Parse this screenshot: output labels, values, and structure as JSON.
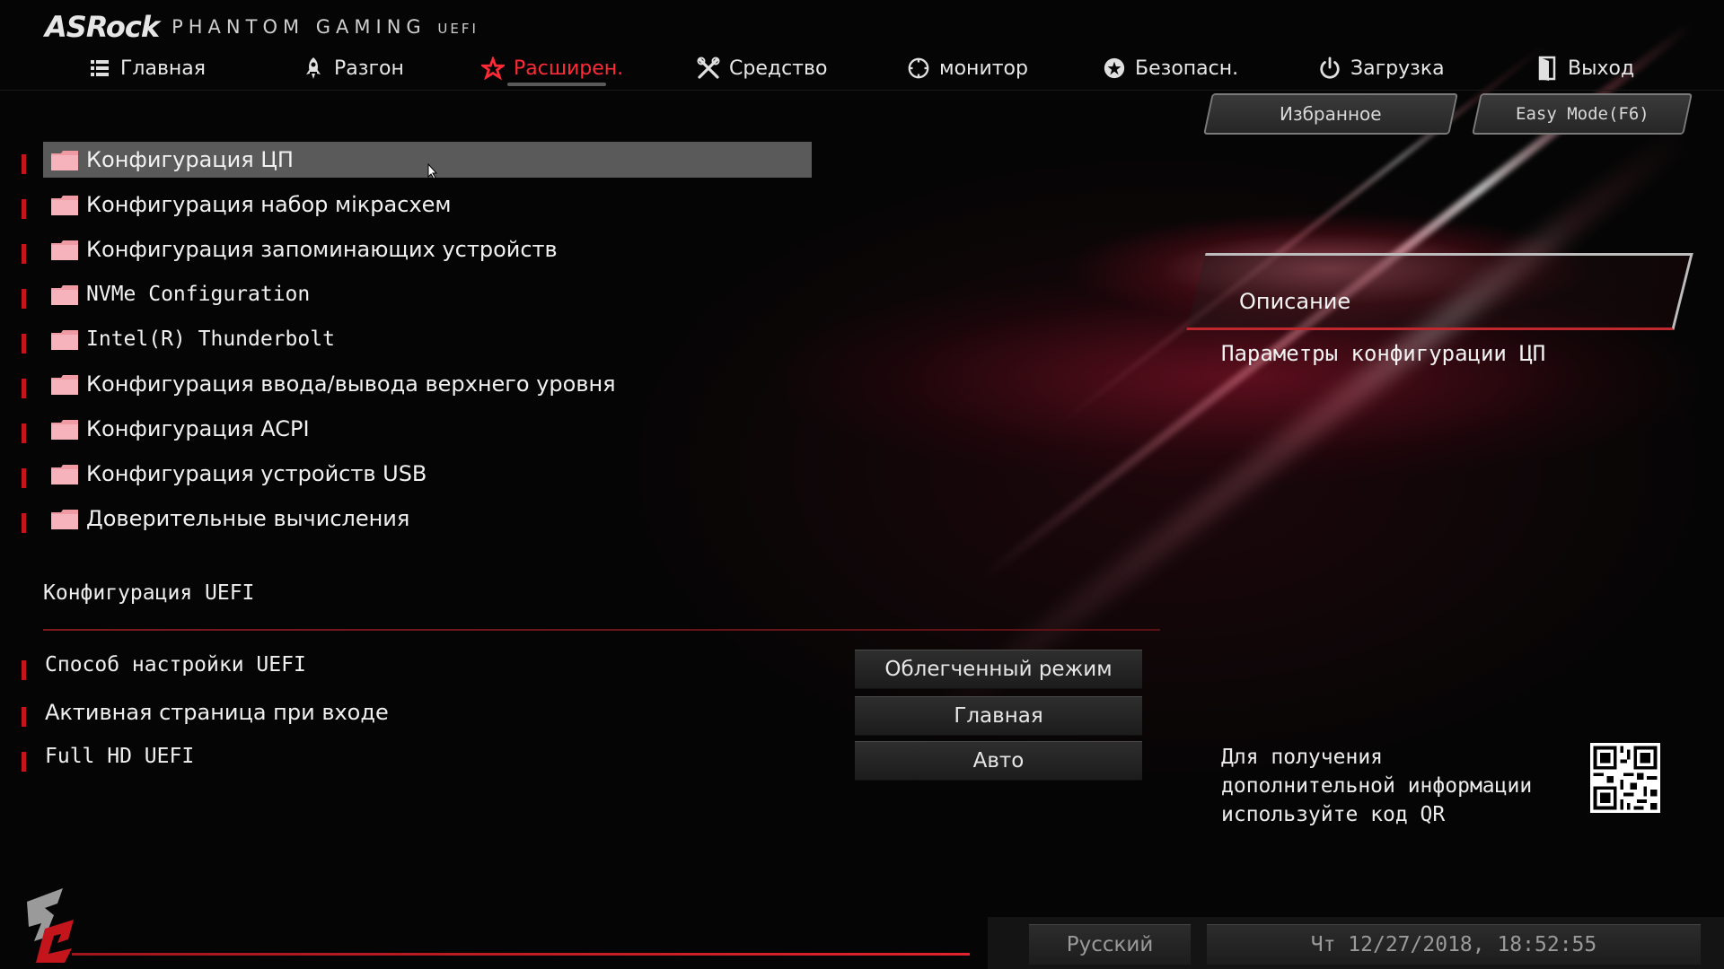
{
  "brand": {
    "logo": "ASRock",
    "product": "PHANTOM GAMING",
    "suffix": "UEFI"
  },
  "nav": {
    "items": [
      {
        "label": "Главная",
        "icon": "list-icon"
      },
      {
        "label": "Разгон",
        "icon": "rocket-icon"
      },
      {
        "label": "Расширен.",
        "icon": "star-icon",
        "active": true
      },
      {
        "label": "Средство",
        "icon": "tools-icon"
      },
      {
        "label": "монитор",
        "icon": "gauge-icon"
      },
      {
        "label": "Безопасн.",
        "icon": "shield-icon"
      },
      {
        "label": "Загрузка",
        "icon": "power-icon"
      },
      {
        "label": "Выход",
        "icon": "exit-door-icon"
      }
    ],
    "accent": "#ff2a35"
  },
  "top_buttons": {
    "favorites": "Избранное",
    "easy_mode": "Easy Mode(F6)"
  },
  "menu": {
    "items": [
      {
        "label": "Конфигурация ЦП",
        "selected": true
      },
      {
        "label": "Конфигурация набор мікрасхем"
      },
      {
        "label": "Конфигурация запоминающих устройств"
      },
      {
        "label": "NVMe Configuration"
      },
      {
        "label": "Intel(R) Thunderbolt"
      },
      {
        "label": "Конфигурация ввода/вывода верхнего уровня"
      },
      {
        "label": "Конфигурация ACPI"
      },
      {
        "label": "Конфигурация устройств USB"
      },
      {
        "label": "Доверительные вычисления"
      }
    ]
  },
  "uefi_section": {
    "title": "Конфигурация UEFI",
    "options": [
      {
        "label": "Способ настройки UEFI",
        "value": "Облегченный режим"
      },
      {
        "label": "Активная страница при входе",
        "value": "Главная"
      },
      {
        "label": "Full HD UEFI",
        "value": "Авто"
      }
    ]
  },
  "description": {
    "title": "Описание",
    "text": "Параметры конфигурации ЦП"
  },
  "qr": {
    "text_line1": "Для получения",
    "text_line2": "дополнительной информации",
    "text_line3": "используйте код QR"
  },
  "footer": {
    "language": "Русский",
    "datetime": "Чт 12/27/2018, 18:52:55"
  },
  "colors": {
    "marker": "#c4151c",
    "highlight": "#5a5a5a"
  }
}
